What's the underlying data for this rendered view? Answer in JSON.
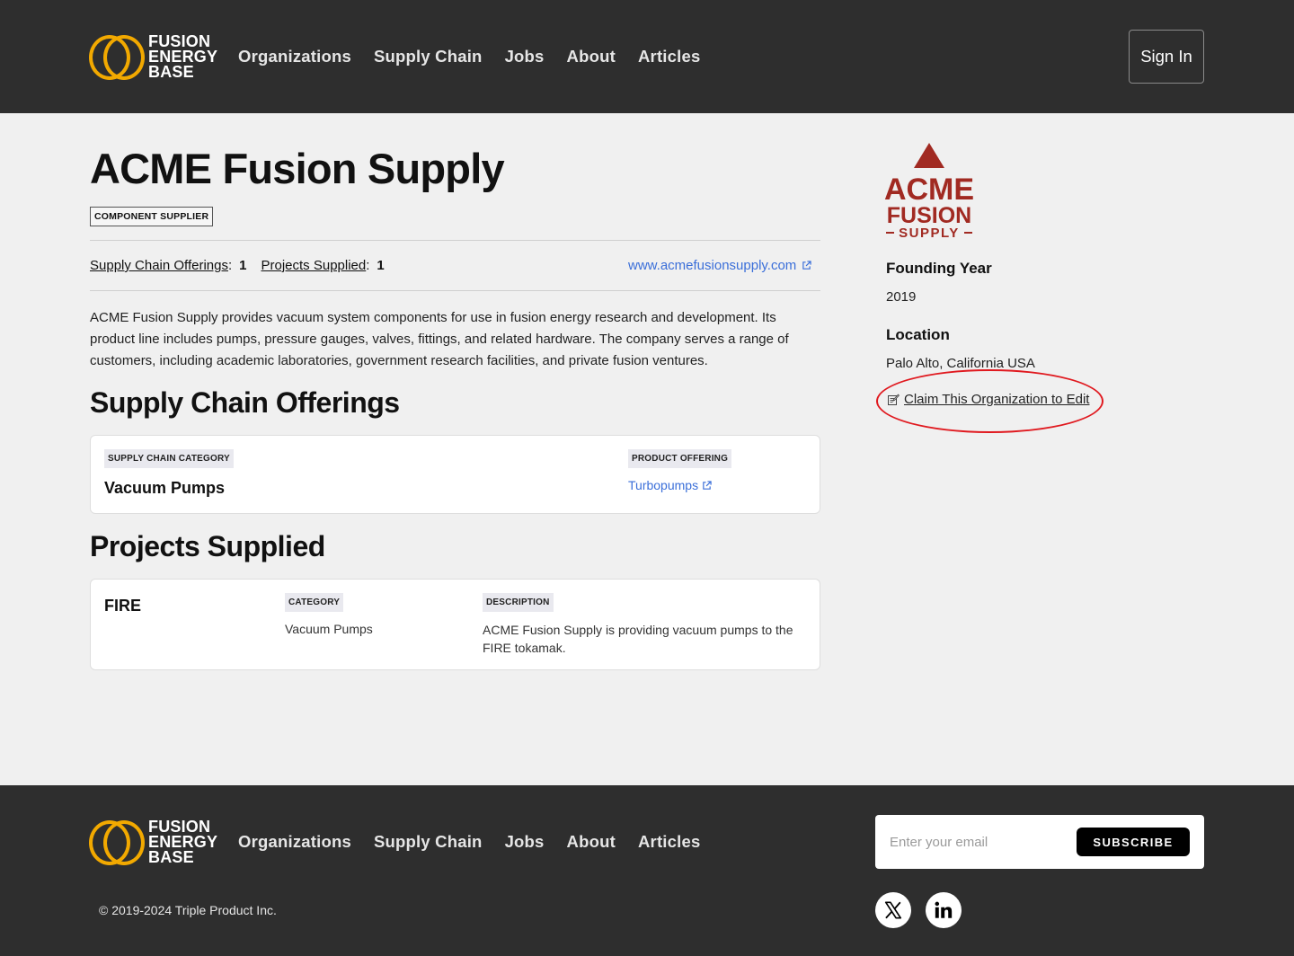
{
  "brand": {
    "line1": "FUSION",
    "line2": "ENERGY",
    "line3": "BASE"
  },
  "nav": [
    {
      "label": "Organizations"
    },
    {
      "label": "Supply Chain"
    },
    {
      "label": "Jobs"
    },
    {
      "label": "About"
    },
    {
      "label": "Articles"
    }
  ],
  "header": {
    "sign_in_label": "Sign In"
  },
  "org": {
    "name": "ACME Fusion Supply",
    "type_badge": "COMPONENT SUPPLIER",
    "supply_chain_offerings_label": "Supply Chain Offerings",
    "supply_chain_offerings_count": "1",
    "projects_supplied_label": "Projects Supplied",
    "projects_supplied_count": "1",
    "website": "www.acmefusionsupply.com",
    "description": "ACME Fusion Supply provides vacuum system components for use in fusion  energy research and development. Its product line includes pumps,  pressure gauges, valves, fittings, and related hardware. The company  serves a range of customers, including academic laboratories, government research facilities, and private fusion ventures.",
    "logo": {
      "line1": "ACME",
      "line2": "FUSION",
      "line3": "SUPPLY",
      "color": "#a12a22"
    },
    "founding_year_label": "Founding Year",
    "founding_year": "2019",
    "location_label": "Location",
    "location": "Palo Alto, California USA",
    "claim_label": "Claim This Organization to Edit"
  },
  "offerings": {
    "heading": "Supply Chain Offerings",
    "category_chip": "SUPPLY CHAIN CATEGORY",
    "category": "Vacuum Pumps",
    "product_chip": "PRODUCT OFFERING",
    "product": "Turbopumps"
  },
  "projects": {
    "heading": "Projects Supplied",
    "name": "FIRE",
    "category_chip": "CATEGORY",
    "category": "Vacuum Pumps",
    "description_chip": "DESCRIPTION",
    "description": "ACME Fusion Supply is providing vacuum pumps to the FIRE tokamak."
  },
  "footer": {
    "email_placeholder": "Enter your email",
    "subscribe_label": "SUBSCRIBE",
    "copyright": "© 2019-2024 Triple Product Inc."
  },
  "colors": {
    "header_bg": "#2e2e2e",
    "accent_ring": "#f2a900",
    "link": "#3b6fd9",
    "annotation": "#e0191f"
  }
}
